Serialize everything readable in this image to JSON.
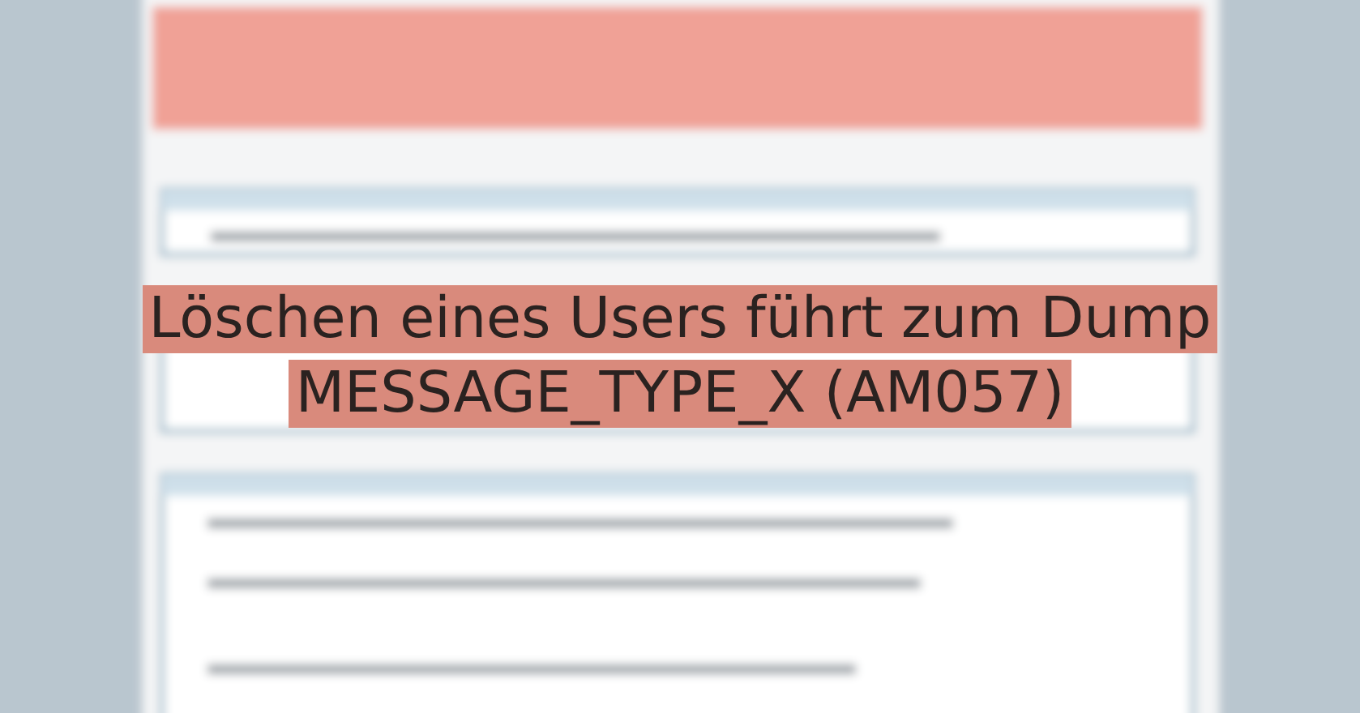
{
  "headline": {
    "lines": [
      "Löschen eines Users führt zum Dump",
      "MESSAGE_TYPE_X (AM057)"
    ]
  }
}
